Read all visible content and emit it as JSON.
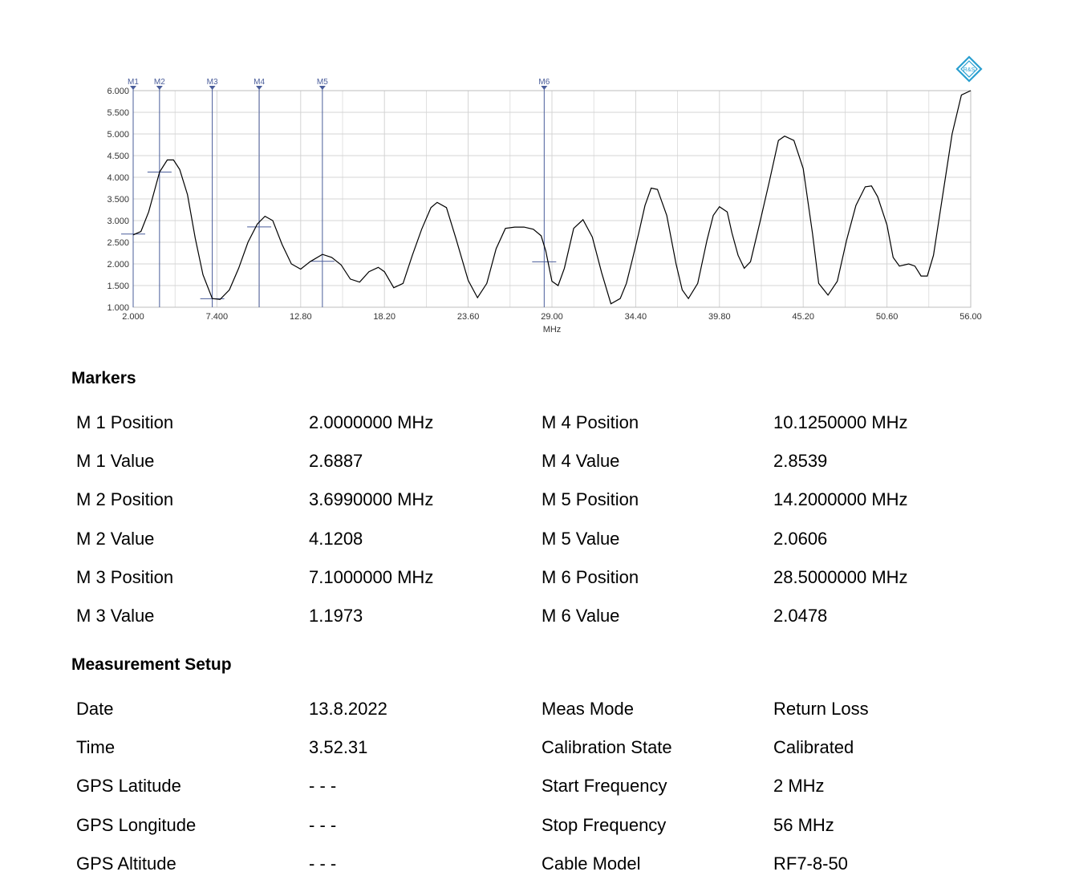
{
  "chart_data": {
    "type": "line",
    "xlabel": "MHz",
    "ylabel": "",
    "xlim": [
      2.0,
      56.0
    ],
    "ylim": [
      1.0,
      6.0
    ],
    "x_ticks": [
      "2.000",
      "7.400",
      "12.80",
      "18.20",
      "23.60",
      "29.00",
      "34.40",
      "39.80",
      "45.20",
      "50.60",
      "56.00"
    ],
    "y_ticks": [
      "1.000",
      "1.500",
      "2.000",
      "2.500",
      "3.000",
      "3.500",
      "4.000",
      "4.500",
      "5.000",
      "5.500",
      "6.000"
    ],
    "grid": true,
    "series": [
      {
        "x": [
          2.0,
          2.5,
          3.0,
          3.7,
          4.2,
          4.6,
          5.0,
          5.5,
          6.0,
          6.5,
          7.1,
          7.6,
          8.2,
          8.8,
          9.4,
          10.0,
          10.5,
          11.0,
          11.6,
          12.2,
          12.8,
          13.4,
          14.2,
          14.8,
          15.4,
          16.0,
          16.6,
          17.2,
          17.8,
          18.2,
          18.8,
          19.4,
          20.0,
          20.6,
          21.2,
          21.6,
          22.2,
          22.8,
          23.6,
          24.2,
          24.8,
          25.4,
          26.0,
          26.6,
          27.2,
          27.8,
          28.3,
          28.6,
          29.0,
          29.4,
          29.8,
          30.4,
          31.0,
          31.6,
          32.2,
          32.8,
          33.4,
          33.8,
          34.2,
          34.6,
          35.0,
          35.4,
          35.8,
          36.4,
          37.0,
          37.4,
          37.8,
          38.4,
          39.0,
          39.4,
          39.8,
          40.3,
          40.6,
          41.0,
          41.4,
          41.8,
          42.4,
          43.0,
          43.6,
          44.0,
          44.6,
          45.2,
          45.8,
          46.2,
          46.8,
          47.4,
          48.0,
          48.6,
          49.2,
          49.6,
          50.0,
          50.6,
          51.0,
          51.4,
          52.0,
          52.4,
          52.8,
          53.2,
          53.6,
          54.2,
          54.8,
          55.4,
          56.0
        ],
        "values": [
          2.67,
          2.75,
          3.2,
          4.12,
          4.4,
          4.4,
          4.18,
          3.6,
          2.6,
          1.75,
          1.2,
          1.18,
          1.4,
          1.9,
          2.5,
          2.92,
          3.1,
          3.0,
          2.45,
          2.0,
          1.88,
          2.05,
          2.22,
          2.15,
          1.98,
          1.65,
          1.58,
          1.82,
          1.92,
          1.82,
          1.45,
          1.55,
          2.2,
          2.8,
          3.3,
          3.42,
          3.3,
          2.6,
          1.62,
          1.22,
          1.55,
          2.35,
          2.82,
          2.85,
          2.85,
          2.8,
          2.65,
          2.3,
          1.6,
          1.5,
          1.9,
          2.82,
          3.02,
          2.62,
          1.8,
          1.08,
          1.2,
          1.55,
          2.12,
          2.72,
          3.35,
          3.75,
          3.72,
          3.12,
          2.0,
          1.4,
          1.2,
          1.55,
          2.55,
          3.12,
          3.32,
          3.2,
          2.72,
          2.2,
          1.9,
          2.05,
          2.95,
          3.88,
          4.85,
          4.95,
          4.85,
          4.2,
          2.7,
          1.55,
          1.28,
          1.6,
          2.55,
          3.35,
          3.78,
          3.8,
          3.55,
          2.9,
          2.15,
          1.95,
          2.0,
          1.95,
          1.72,
          1.72,
          2.2,
          3.6,
          5.0,
          5.9,
          6.0
        ]
      }
    ],
    "markers": [
      {
        "label": "M1",
        "x": 2.0,
        "y": 2.6887
      },
      {
        "label": "M2",
        "x": 3.699,
        "y": 4.1208
      },
      {
        "label": "M3",
        "x": 7.1,
        "y": 1.1973
      },
      {
        "label": "M4",
        "x": 10.125,
        "y": 2.8539
      },
      {
        "label": "M5",
        "x": 14.2,
        "y": 2.0606
      },
      {
        "label": "M6",
        "x": 28.5,
        "y": 2.0478
      }
    ]
  },
  "colors": {
    "trace": "#000000",
    "marker_line": "#4a5d9a",
    "grid": "#d4d4d4",
    "logo": "#2a9fd0"
  },
  "logo": {
    "text": "R&S"
  },
  "markers_section": {
    "title": "Markers",
    "rows": [
      [
        "M 1 Position",
        "2.0000000 MHz",
        "M 4 Position",
        "10.1250000 MHz"
      ],
      [
        "M 1 Value",
        "2.6887",
        "M 4 Value",
        "2.8539"
      ],
      [
        "M 2 Position",
        "3.6990000 MHz",
        "M 5 Position",
        "14.2000000 MHz"
      ],
      [
        "M 2 Value",
        "4.1208",
        "M 5 Value",
        "2.0606"
      ],
      [
        "M 3 Position",
        "7.1000000 MHz",
        "M 6 Position",
        "28.5000000 MHz"
      ],
      [
        "M 3 Value",
        "1.1973",
        "M 6 Value",
        "2.0478"
      ]
    ]
  },
  "setup_section": {
    "title": "Measurement Setup",
    "rows": [
      [
        "Date",
        "13.8.2022",
        "Meas Mode",
        "Return Loss"
      ],
      [
        "Time",
        "3.52.31",
        "Calibration State",
        "Calibrated"
      ],
      [
        "GPS Latitude",
        "- - -",
        "Start Frequency",
        "2 MHz"
      ],
      [
        "GPS Longitude",
        "- - -",
        "Stop Frequency",
        "56 MHz"
      ],
      [
        "GPS Altitude",
        "- - -",
        "Cable Model",
        "RF7-8-50"
      ]
    ]
  }
}
